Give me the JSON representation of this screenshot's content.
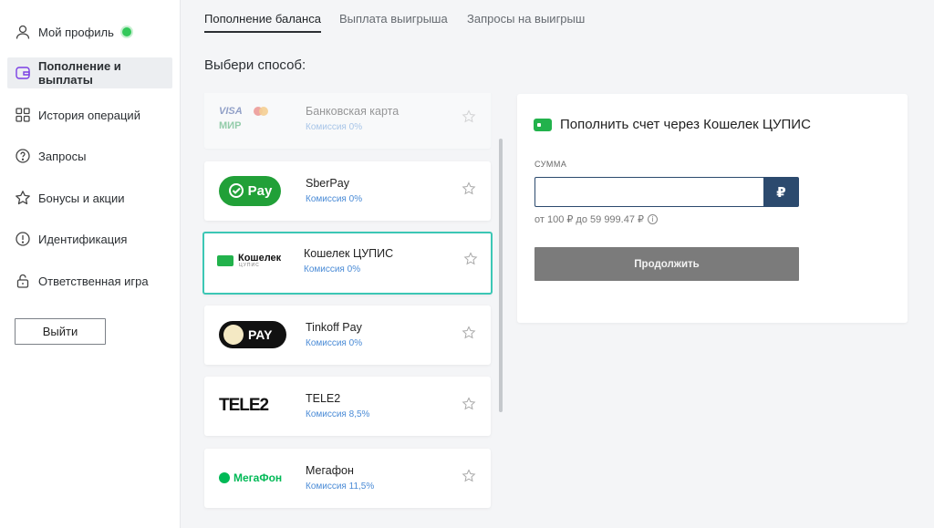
{
  "sidebar": {
    "items": [
      {
        "label": "Мой профиль",
        "icon": "user-icon",
        "online": true
      },
      {
        "label": "Пополнение и выплаты",
        "icon": "wallet-icon",
        "active": true
      },
      {
        "label": "История операций",
        "icon": "grid-icon"
      },
      {
        "label": "Запросы",
        "icon": "question-icon"
      },
      {
        "label": "Бонусы и акции",
        "icon": "star-icon"
      },
      {
        "label": "Идентификация",
        "icon": "exclamation-icon"
      },
      {
        "label": "Ответственная игра",
        "icon": "lock-icon"
      }
    ],
    "logout_label": "Выйти",
    "accent": "#7b3fe4",
    "online_color": "#32c85a"
  },
  "tabs": [
    {
      "label": "Пополнение баланса",
      "active": true
    },
    {
      "label": "Выплата выигрыша"
    },
    {
      "label": "Запросы на выигрыш"
    }
  ],
  "section_title": "Выбери способ:",
  "methods": [
    {
      "name": "Банковская карта",
      "fee": "Комиссия 0%",
      "logo": {
        "line1": "VISA",
        "line2": "МИР"
      }
    },
    {
      "name": "SberPay",
      "fee": "Комиссия 0%",
      "logo": {
        "text": "Pay"
      }
    },
    {
      "name": "Кошелек ЦУПИС",
      "fee": "Комиссия 0%",
      "logo": {
        "text": "Кошелек",
        "sub": "ЦУПИС"
      }
    },
    {
      "name": "Tinkoff Pay",
      "fee": "Комиссия 0%",
      "logo": {
        "text": "PAY"
      }
    },
    {
      "name": "TELE2",
      "fee": "Комиссия 8,5%",
      "logo": {
        "text": "TELE2"
      }
    },
    {
      "name": "Мегафон",
      "fee": "Комиссия 11,5%",
      "logo": {
        "text": "МегаФон"
      }
    }
  ],
  "panel": {
    "title": "Пополнить счет через Кошелек ЦУПИС",
    "amount_label": "СУММА",
    "amount_value": "",
    "currency": "₽",
    "range_text": "от 100 ₽ до 59 999.47 ₽",
    "info_glyph": "i",
    "continue_label": "Продолжить"
  },
  "colors": {
    "selected_border": "#3cc7b5",
    "fee_text": "#4a8bd6",
    "sber_green": "#21a038",
    "wallet_green": "#22b24c",
    "megafon_green": "#00b956",
    "currency_bg": "#2c4a6e",
    "continue_bg": "#7b7b7b"
  }
}
